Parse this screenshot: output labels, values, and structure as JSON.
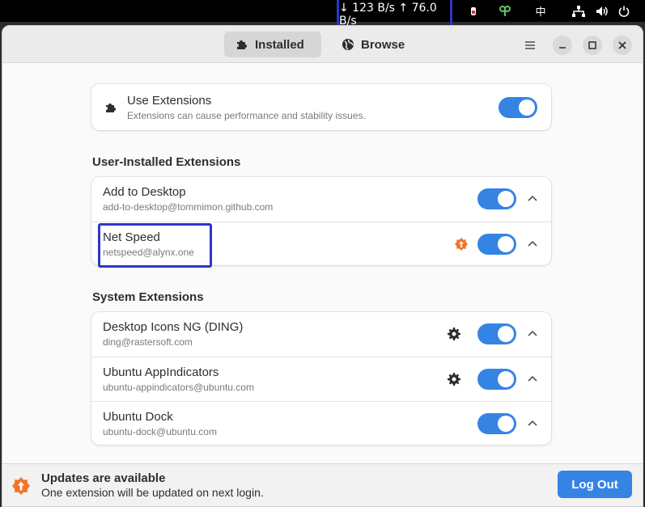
{
  "system_bar": {
    "netspeed": "↓ 123 B/s ↑ 76.0 B/s",
    "input_method": "中",
    "icons": [
      "pet-icon",
      "clover-icon",
      "input-method-indicator",
      "network-icon",
      "volume-icon",
      "power-icon"
    ]
  },
  "header": {
    "tabs": [
      {
        "label": "Installed",
        "icon": "puzzle-icon",
        "active": true
      },
      {
        "label": "Browse",
        "icon": "globe-icon",
        "active": false
      }
    ],
    "buttons": [
      "menu-icon",
      "minimize-icon",
      "maximize-icon",
      "close-icon"
    ]
  },
  "use_extensions": {
    "title": "Use Extensions",
    "subtitle": "Extensions can cause performance and stability issues.",
    "enabled": true
  },
  "user_section": {
    "title": "User-Installed Extensions",
    "items": [
      {
        "name": "Add to Desktop",
        "id": "add-to-desktop@tommimon.github.com",
        "enabled": true,
        "update": false,
        "settings": false
      },
      {
        "name": "Net Speed",
        "id": "netspeed@alynx.one",
        "enabled": true,
        "update": true,
        "settings": false
      }
    ]
  },
  "system_section": {
    "title": "System Extensions",
    "items": [
      {
        "name": "Desktop Icons NG (DING)",
        "id": "ding@rastersoft.com",
        "enabled": true,
        "settings": true
      },
      {
        "name": "Ubuntu AppIndicators",
        "id": "ubuntu-appindicators@ubuntu.com",
        "enabled": true,
        "settings": true
      },
      {
        "name": "Ubuntu Dock",
        "id": "ubuntu-dock@ubuntu.com",
        "enabled": true,
        "settings": false
      }
    ]
  },
  "footer": {
    "title": "Updates are available",
    "subtitle": "One extension will be updated on next login.",
    "button": "Log Out"
  },
  "colors": {
    "accent": "#3584e4",
    "update_badge": "#f37329",
    "highlight": "#2c36c8"
  }
}
